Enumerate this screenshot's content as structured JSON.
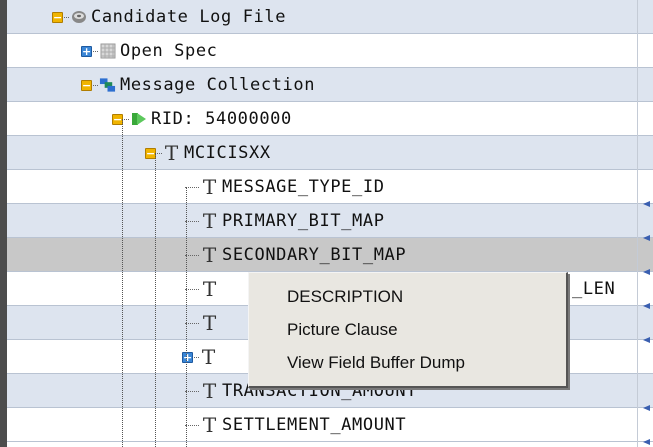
{
  "tree": [
    {
      "label": "Candidate Log File",
      "icon": "database-icon",
      "expander": "open"
    },
    {
      "label": "Open Spec",
      "icon": "spec-grid-icon",
      "expander": "closed"
    },
    {
      "label": "Message Collection",
      "icon": "message-collection-icon",
      "expander": "open"
    },
    {
      "label": "RID: 54000000",
      "icon": "record-play-icon",
      "expander": "open"
    },
    {
      "label": "MCICISXX",
      "icon": "text-field-icon",
      "expander": "open"
    },
    {
      "label": "MESSAGE_TYPE_ID",
      "icon": "text-field-icon"
    },
    {
      "label": "PRIMARY_BIT_MAP",
      "icon": "text-field-icon"
    },
    {
      "label": "SECONDARY_BIT_MAP",
      "icon": "text-field-icon"
    },
    {
      "label": "_LEN",
      "icon": "text-field-icon"
    },
    {
      "label": "",
      "icon": "text-field-icon"
    },
    {
      "label": "",
      "icon": "text-field-icon",
      "expander": "closed"
    },
    {
      "label": "TRANSACTION_AMOUNT",
      "icon": "text-field-icon"
    },
    {
      "label": "SETTLEMENT_AMOUNT",
      "icon": "text-field-icon"
    }
  ],
  "context_menu": {
    "items": [
      "DESCRIPTION",
      "Picture Clause",
      "View Field Buffer Dump"
    ]
  }
}
